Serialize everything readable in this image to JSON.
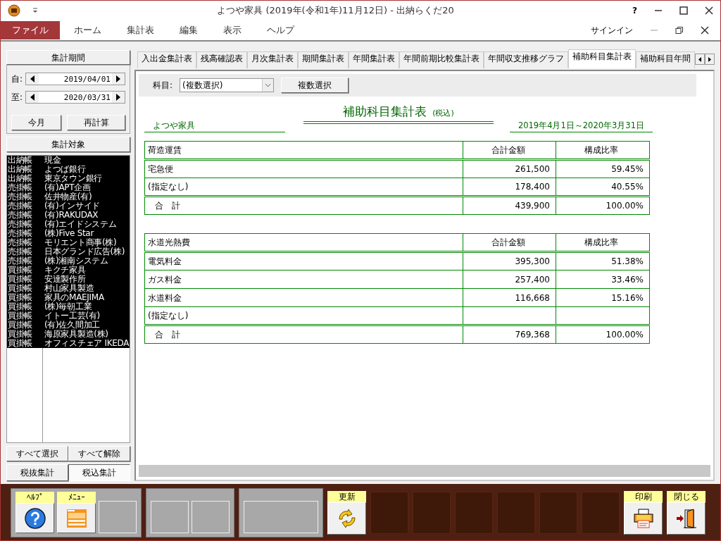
{
  "window": {
    "title": "よつや家具 (2019年(令和1年)11月12日) - 出納らくだ20",
    "help": "?"
  },
  "menu": [
    {
      "label": "ファイル",
      "selected": true
    },
    {
      "label": "ホーム",
      "selected": false
    },
    {
      "label": "集計表",
      "selected": false
    },
    {
      "label": "編集",
      "selected": false
    },
    {
      "label": "表示",
      "selected": false
    },
    {
      "label": "ヘルプ",
      "selected": false
    }
  ],
  "account": {
    "sign_in": "サインイン"
  },
  "period": {
    "header": "集計期間",
    "from_label": "自:",
    "from": "2019/04/01",
    "to_label": "至:",
    "to": "2020/03/31",
    "buttons": [
      "今月",
      "再計算"
    ]
  },
  "targets": {
    "header": "集計対象",
    "rows": [
      {
        "book": "出納帳",
        "name": "現金",
        "selected": true
      },
      {
        "book": "出納帳",
        "name": "よつば銀行",
        "selected": true
      },
      {
        "book": "出納帳",
        "name": "東京タウン銀行",
        "selected": true
      },
      {
        "book": "売掛帳",
        "name": "(有)APT企画",
        "selected": true
      },
      {
        "book": "売掛帳",
        "name": "佐井物産(有)",
        "selected": true
      },
      {
        "book": "売掛帳",
        "name": "(有)インサイド",
        "selected": true
      },
      {
        "book": "売掛帳",
        "name": "(有)RAKUDAX",
        "selected": true
      },
      {
        "book": "売掛帳",
        "name": "(有)エイドシステム",
        "selected": true
      },
      {
        "book": "売掛帳",
        "name": "(株)Five Star",
        "selected": true
      },
      {
        "book": "売掛帳",
        "name": "モリエント商事(株)",
        "selected": true
      },
      {
        "book": "売掛帳",
        "name": "日本グランド広告(株)",
        "selected": true
      },
      {
        "book": "売掛帳",
        "name": "(株)湘南システム",
        "selected": true
      },
      {
        "book": "買掛帳",
        "name": "キクチ家具",
        "selected": true
      },
      {
        "book": "買掛帳",
        "name": "安達製作所",
        "selected": true
      },
      {
        "book": "買掛帳",
        "name": "村山家具製造",
        "selected": true
      },
      {
        "book": "買掛帳",
        "name": "家具のMAEJIMA",
        "selected": true
      },
      {
        "book": "買掛帳",
        "name": "(株)毎朝工業",
        "selected": true
      },
      {
        "book": "買掛帳",
        "name": "イトー工芸(有)",
        "selected": true
      },
      {
        "book": "買掛帳",
        "name": "(有)佐久間加工",
        "selected": true
      },
      {
        "book": "買掛帳",
        "name": "海原家具製造(株)",
        "selected": true
      },
      {
        "book": "買掛帳",
        "name": "オフィスチェア IKEDA",
        "selected": true
      }
    ],
    "buttons": [
      "すべて選択",
      "すべて解除"
    ]
  },
  "tax_modes": [
    {
      "label": "税抜集計",
      "selected": false
    },
    {
      "label": "税込集計",
      "selected": true
    }
  ],
  "tabs": [
    {
      "label": "入出金集計表",
      "selected": false
    },
    {
      "label": "残高確認表",
      "selected": false
    },
    {
      "label": "月次集計表",
      "selected": false
    },
    {
      "label": "期間集計表",
      "selected": false
    },
    {
      "label": "年間集計表",
      "selected": false
    },
    {
      "label": "年間前期比較集計表",
      "selected": false
    },
    {
      "label": "年間収支推移グラフ",
      "selected": false
    },
    {
      "label": "補助科目集計表",
      "selected": true
    },
    {
      "label": "補助科目年間",
      "selected": false
    }
  ],
  "filter": {
    "label": "科目:",
    "value": "(複数選択)",
    "button": "複数選択"
  },
  "report": {
    "title": "補助科目集計表",
    "title_note": "(税込)",
    "company": "よつや家具",
    "period": "2019年4月1日～2020年3月31日",
    "tables": [
      {
        "header": [
          "荷造運賃",
          "合計金額",
          "構成比率"
        ],
        "rows": [
          {
            "name": "宅急便",
            "amount": "261,500",
            "ratio": "59.45%"
          },
          {
            "name": "(指定なし)",
            "amount": "178,400",
            "ratio": "40.55%"
          }
        ],
        "total": {
          "label": "合　計",
          "amount": "439,900",
          "ratio": "100.00%"
        }
      },
      {
        "header": [
          "水道光熱費",
          "合計金額",
          "構成比率"
        ],
        "rows": [
          {
            "name": "電気料金",
            "amount": "395,300",
            "ratio": "51.38%"
          },
          {
            "name": "ガス料金",
            "amount": "257,400",
            "ratio": "33.46%"
          },
          {
            "name": "水道料金",
            "amount": "116,668",
            "ratio": "15.16%"
          },
          {
            "name": "(指定なし)"
          }
        ],
        "total": {
          "label": "合　計",
          "amount": "769,368",
          "ratio": "100.00%"
        }
      }
    ]
  },
  "toolbar": [
    {
      "kind": "panel",
      "slots": [
        {
          "kind": "help",
          "label": "ﾍﾙﾌﾟ"
        },
        {
          "kind": "menu",
          "label": "ﾒﾆｭｰ"
        },
        {
          "kind": "blank"
        }
      ]
    },
    {
      "kind": "panel",
      "slots": [
        {
          "kind": "blank"
        },
        {
          "kind": "blank"
        }
      ]
    },
    {
      "kind": "panel",
      "slots": [
        {
          "kind": "wide"
        }
      ]
    },
    {
      "kind": "refresh",
      "label": "更新"
    },
    {
      "kind": "dark"
    },
    {
      "kind": "dark"
    },
    {
      "kind": "dark"
    },
    {
      "kind": "dark"
    },
    {
      "kind": "dark"
    },
    {
      "kind": "dark"
    },
    {
      "kind": "print",
      "label": "印刷"
    },
    {
      "kind": "exit",
      "label": "閉じる"
    }
  ]
}
